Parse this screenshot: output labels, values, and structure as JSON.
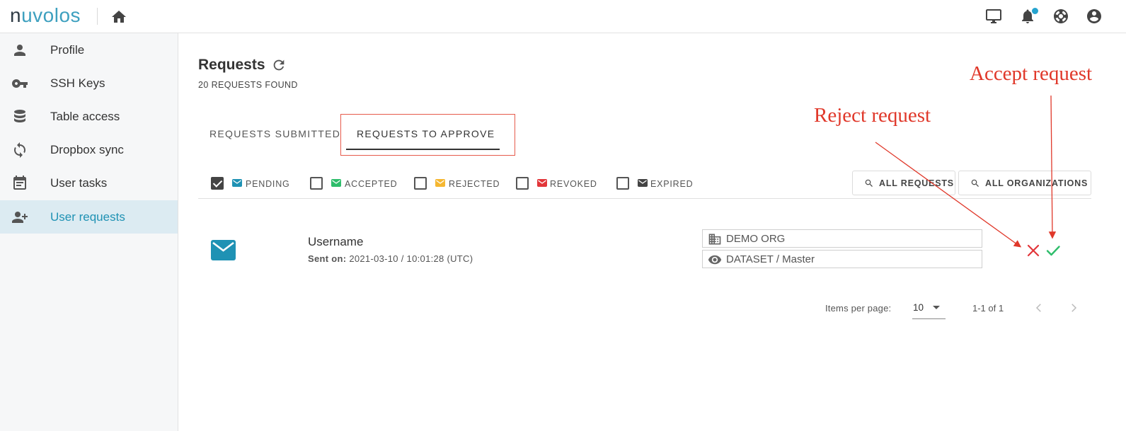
{
  "app": {
    "logo_n": "n",
    "logo_rest": "uvolos"
  },
  "colors": {
    "accent": "#1f92b4",
    "pending": "#1f92b4",
    "accepted": "#2ebd6b",
    "rejected": "#f5b731",
    "revoked": "#e2363a",
    "expired": "#444444",
    "annotation": "#e0382a"
  },
  "topbar": {
    "icons": [
      "home-icon",
      "monitor-icon",
      "bell-icon",
      "lifebuoy-icon",
      "account-icon"
    ]
  },
  "sidebar": {
    "items": [
      {
        "label": "Profile",
        "icon": "person-icon"
      },
      {
        "label": "SSH Keys",
        "icon": "key-icon"
      },
      {
        "label": "Table access",
        "icon": "database-icon"
      },
      {
        "label": "Dropbox sync",
        "icon": "sync-icon"
      },
      {
        "label": "User tasks",
        "icon": "calendar-icon"
      },
      {
        "label": "User requests",
        "icon": "person-add-icon",
        "active": true
      }
    ]
  },
  "main": {
    "title": "Requests",
    "count_text": "20 REQUESTS FOUND",
    "tabs": [
      {
        "label": "REQUESTS SUBMITTED"
      },
      {
        "label": "REQUESTS TO APPROVE",
        "active": true
      }
    ],
    "filters": [
      {
        "label": "PENDING",
        "checked": true
      },
      {
        "label": "ACCEPTED",
        "checked": false
      },
      {
        "label": "REJECTED",
        "checked": false
      },
      {
        "label": "REVOKED",
        "checked": false
      },
      {
        "label": "EXPIRED",
        "checked": false
      }
    ],
    "buttons": {
      "all_requests": "ALL REQUESTS",
      "all_organizations": "ALL ORGANIZATIONS"
    },
    "requests": [
      {
        "username": "Username",
        "sent_label": "Sent on:",
        "sent_value": "2021-03-10 / 10:01:28 (UTC)",
        "org": "DEMO ORG",
        "dataset": "DATASET / Master"
      }
    ],
    "pagination": {
      "items_per_page_label": "Items per page:",
      "items_per_page": "10",
      "range": "1-1 of 1"
    }
  },
  "annotations": {
    "reject": "Reject request",
    "accept": "Accept request"
  }
}
